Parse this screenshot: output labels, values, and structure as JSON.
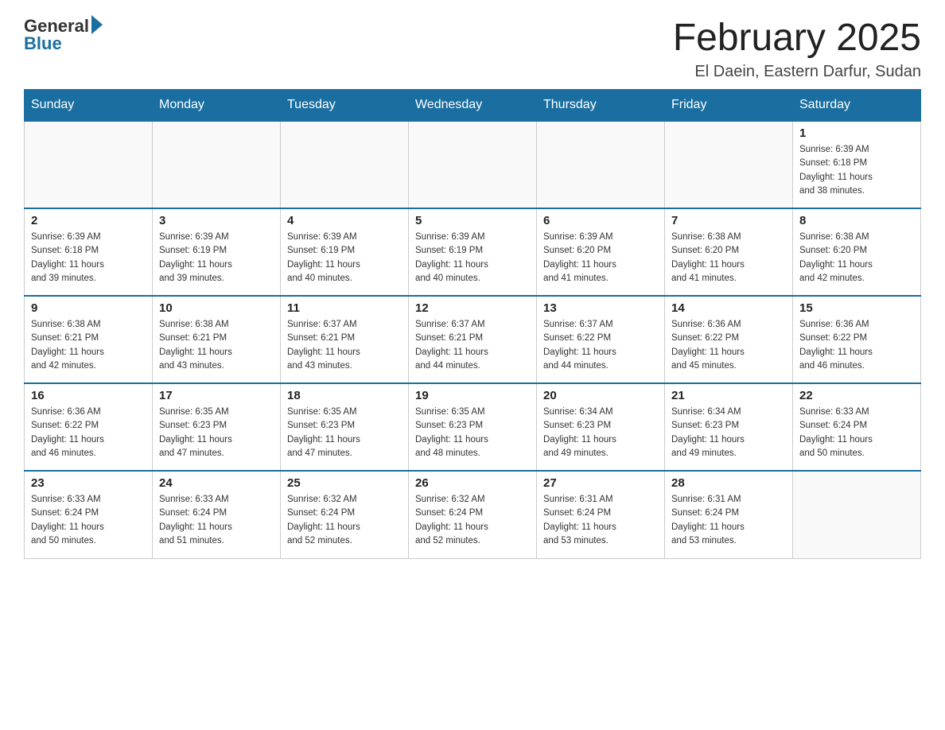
{
  "logo": {
    "general": "General",
    "blue": "Blue"
  },
  "title": {
    "month": "February 2025",
    "location": "El Daein, Eastern Darfur, Sudan"
  },
  "days_of_week": [
    "Sunday",
    "Monday",
    "Tuesday",
    "Wednesday",
    "Thursday",
    "Friday",
    "Saturday"
  ],
  "weeks": [
    {
      "days": [
        {
          "num": "",
          "info": "",
          "empty": true
        },
        {
          "num": "",
          "info": "",
          "empty": true
        },
        {
          "num": "",
          "info": "",
          "empty": true
        },
        {
          "num": "",
          "info": "",
          "empty": true
        },
        {
          "num": "",
          "info": "",
          "empty": true
        },
        {
          "num": "",
          "info": "",
          "empty": true
        },
        {
          "num": "1",
          "info": "Sunrise: 6:39 AM\nSunset: 6:18 PM\nDaylight: 11 hours\nand 38 minutes.",
          "empty": false
        }
      ]
    },
    {
      "days": [
        {
          "num": "2",
          "info": "Sunrise: 6:39 AM\nSunset: 6:18 PM\nDaylight: 11 hours\nand 39 minutes.",
          "empty": false
        },
        {
          "num": "3",
          "info": "Sunrise: 6:39 AM\nSunset: 6:19 PM\nDaylight: 11 hours\nand 39 minutes.",
          "empty": false
        },
        {
          "num": "4",
          "info": "Sunrise: 6:39 AM\nSunset: 6:19 PM\nDaylight: 11 hours\nand 40 minutes.",
          "empty": false
        },
        {
          "num": "5",
          "info": "Sunrise: 6:39 AM\nSunset: 6:19 PM\nDaylight: 11 hours\nand 40 minutes.",
          "empty": false
        },
        {
          "num": "6",
          "info": "Sunrise: 6:39 AM\nSunset: 6:20 PM\nDaylight: 11 hours\nand 41 minutes.",
          "empty": false
        },
        {
          "num": "7",
          "info": "Sunrise: 6:38 AM\nSunset: 6:20 PM\nDaylight: 11 hours\nand 41 minutes.",
          "empty": false
        },
        {
          "num": "8",
          "info": "Sunrise: 6:38 AM\nSunset: 6:20 PM\nDaylight: 11 hours\nand 42 minutes.",
          "empty": false
        }
      ]
    },
    {
      "days": [
        {
          "num": "9",
          "info": "Sunrise: 6:38 AM\nSunset: 6:21 PM\nDaylight: 11 hours\nand 42 minutes.",
          "empty": false
        },
        {
          "num": "10",
          "info": "Sunrise: 6:38 AM\nSunset: 6:21 PM\nDaylight: 11 hours\nand 43 minutes.",
          "empty": false
        },
        {
          "num": "11",
          "info": "Sunrise: 6:37 AM\nSunset: 6:21 PM\nDaylight: 11 hours\nand 43 minutes.",
          "empty": false
        },
        {
          "num": "12",
          "info": "Sunrise: 6:37 AM\nSunset: 6:21 PM\nDaylight: 11 hours\nand 44 minutes.",
          "empty": false
        },
        {
          "num": "13",
          "info": "Sunrise: 6:37 AM\nSunset: 6:22 PM\nDaylight: 11 hours\nand 44 minutes.",
          "empty": false
        },
        {
          "num": "14",
          "info": "Sunrise: 6:36 AM\nSunset: 6:22 PM\nDaylight: 11 hours\nand 45 minutes.",
          "empty": false
        },
        {
          "num": "15",
          "info": "Sunrise: 6:36 AM\nSunset: 6:22 PM\nDaylight: 11 hours\nand 46 minutes.",
          "empty": false
        }
      ]
    },
    {
      "days": [
        {
          "num": "16",
          "info": "Sunrise: 6:36 AM\nSunset: 6:22 PM\nDaylight: 11 hours\nand 46 minutes.",
          "empty": false
        },
        {
          "num": "17",
          "info": "Sunrise: 6:35 AM\nSunset: 6:23 PM\nDaylight: 11 hours\nand 47 minutes.",
          "empty": false
        },
        {
          "num": "18",
          "info": "Sunrise: 6:35 AM\nSunset: 6:23 PM\nDaylight: 11 hours\nand 47 minutes.",
          "empty": false
        },
        {
          "num": "19",
          "info": "Sunrise: 6:35 AM\nSunset: 6:23 PM\nDaylight: 11 hours\nand 48 minutes.",
          "empty": false
        },
        {
          "num": "20",
          "info": "Sunrise: 6:34 AM\nSunset: 6:23 PM\nDaylight: 11 hours\nand 49 minutes.",
          "empty": false
        },
        {
          "num": "21",
          "info": "Sunrise: 6:34 AM\nSunset: 6:23 PM\nDaylight: 11 hours\nand 49 minutes.",
          "empty": false
        },
        {
          "num": "22",
          "info": "Sunrise: 6:33 AM\nSunset: 6:24 PM\nDaylight: 11 hours\nand 50 minutes.",
          "empty": false
        }
      ]
    },
    {
      "days": [
        {
          "num": "23",
          "info": "Sunrise: 6:33 AM\nSunset: 6:24 PM\nDaylight: 11 hours\nand 50 minutes.",
          "empty": false
        },
        {
          "num": "24",
          "info": "Sunrise: 6:33 AM\nSunset: 6:24 PM\nDaylight: 11 hours\nand 51 minutes.",
          "empty": false
        },
        {
          "num": "25",
          "info": "Sunrise: 6:32 AM\nSunset: 6:24 PM\nDaylight: 11 hours\nand 52 minutes.",
          "empty": false
        },
        {
          "num": "26",
          "info": "Sunrise: 6:32 AM\nSunset: 6:24 PM\nDaylight: 11 hours\nand 52 minutes.",
          "empty": false
        },
        {
          "num": "27",
          "info": "Sunrise: 6:31 AM\nSunset: 6:24 PM\nDaylight: 11 hours\nand 53 minutes.",
          "empty": false
        },
        {
          "num": "28",
          "info": "Sunrise: 6:31 AM\nSunset: 6:24 PM\nDaylight: 11 hours\nand 53 minutes.",
          "empty": false
        },
        {
          "num": "",
          "info": "",
          "empty": true
        }
      ]
    }
  ]
}
